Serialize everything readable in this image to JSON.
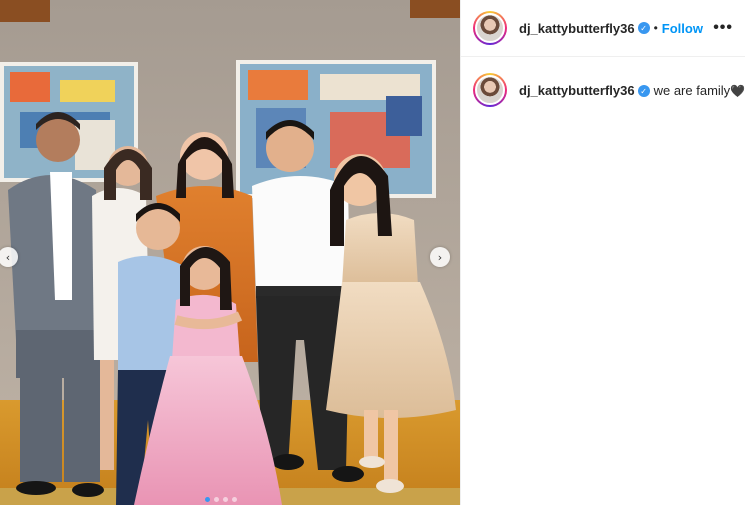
{
  "post": {
    "username": "dj_kattybutterfly36",
    "verified": true,
    "follow_label": "Follow",
    "separator": "•",
    "more_label": "•••",
    "caption_text": "we are family",
    "caption_emoji": "🖤"
  },
  "media": {
    "prev_arrow": "‹",
    "next_arrow": "›",
    "slide_count": 4,
    "active_slide": 1
  },
  "icons": {
    "verified": "verified-badge-icon",
    "more": "more-options-icon",
    "prev": "chevron-left-icon",
    "next": "chevron-right-icon"
  },
  "colors": {
    "follow": "#0095f6",
    "verified": "#3897f0",
    "text": "#262626"
  }
}
